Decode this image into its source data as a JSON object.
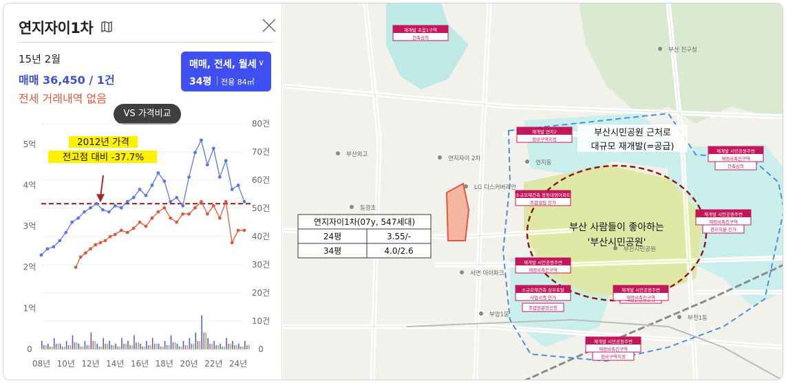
{
  "panel": {
    "title": "연지자이1차",
    "icon": "map-icon",
    "date": "15년 2월",
    "sale_line": "매매 36,450 / 1건",
    "jeonse_line": "전세 거래내역 없음",
    "filter_types": "매매, 전세, 월세",
    "filter_pyeong": "34평",
    "filter_area": "전용 84㎡",
    "vs_button": "VS 가격비교",
    "colors": {
      "accent": "#3f4ff0",
      "sale": "#5b76e8",
      "jeonse": "#e0583c",
      "annotation_bg": "#fff200",
      "dashed_line": "#8b1a1a"
    }
  },
  "chart_data": {
    "type": "line",
    "x_ticks": [
      "08년",
      "10년",
      "12년",
      "14년",
      "16년",
      "18년",
      "20년",
      "22년",
      "24년"
    ],
    "y_left_ticks": [
      "0",
      "1억",
      "2억",
      "3억",
      "4억",
      "5억"
    ],
    "y_right_ticks": [
      "0",
      "10건",
      "20건",
      "30건",
      "40건",
      "50건",
      "60건",
      "70건",
      "80건"
    ],
    "ylim_left": [
      0,
      5.5
    ],
    "ylim_right": [
      0,
      80
    ],
    "annotation_lines": [
      "2012년 가격",
      "전고점 대비 -37.7%"
    ],
    "reference_line_value": 3.55,
    "series": [
      {
        "values_x": [
          2008.0,
          2008.5,
          2009.0,
          2009.5,
          2010.0,
          2010.5,
          2011.0,
          2011.5,
          2012.0,
          2012.5,
          2013.0,
          2013.5,
          2014.0,
          2014.5,
          2015.0,
          2015.5,
          2016.0,
          2016.5,
          2017.0,
          2017.5,
          2018.0,
          2018.5,
          2019.0,
          2019.5,
          2020.0,
          2020.5,
          2021.0,
          2021.5,
          2022.0,
          2022.5,
          2023.0,
          2023.5,
          2024.0,
          2024.5
        ],
        "values_y": [
          2.3,
          2.45,
          2.5,
          2.65,
          2.85,
          3.1,
          3.2,
          3.35,
          3.45,
          3.55,
          3.4,
          3.35,
          3.5,
          3.45,
          3.6,
          3.7,
          3.9,
          3.75,
          4.0,
          4.3,
          4.1,
          3.6,
          3.7,
          3.5,
          4.2,
          4.8,
          5.1,
          4.5,
          4.9,
          4.2,
          4.6,
          3.9,
          4.0,
          3.6
        ]
      },
      {
        "values_x": [
          2010.8,
          2011.2,
          2011.6,
          2012.0,
          2012.4,
          2012.8,
          2013.2,
          2013.6,
          2014.0,
          2014.5,
          2015.0,
          2015.5,
          2016.0,
          2016.5,
          2017.0,
          2017.5,
          2018.0,
          2018.5,
          2019.0,
          2019.5,
          2020.0,
          2020.5,
          2021.0,
          2021.5,
          2022.0,
          2022.5,
          2023.0,
          2023.5,
          2024.0,
          2024.5
        ],
        "values_y": [
          2.0,
          2.25,
          2.35,
          2.45,
          2.55,
          2.6,
          2.65,
          2.75,
          2.8,
          2.9,
          2.85,
          2.95,
          3.1,
          3.0,
          3.2,
          3.35,
          3.45,
          3.2,
          3.1,
          3.3,
          3.3,
          3.45,
          3.6,
          3.3,
          3.5,
          3.2,
          3.6,
          2.6,
          2.9,
          2.9
        ]
      }
    ],
    "volume_series": {
      "values_x": [
        2008.0,
        2008.5,
        2009.0,
        2009.5,
        2010.0,
        2010.5,
        2011.0,
        2011.5,
        2012.0,
        2012.5,
        2013.0,
        2013.5,
        2014.0,
        2014.5,
        2015.0,
        2015.5,
        2016.0,
        2016.5,
        2017.0,
        2017.5,
        2018.0,
        2018.5,
        2019.0,
        2019.5,
        2020.0,
        2020.5,
        2021.0,
        2021.5,
        2022.0,
        2022.5,
        2023.0,
        2023.5,
        2024.0,
        2024.5
      ],
      "values_y": [
        3,
        2,
        4,
        2,
        3,
        5,
        2,
        3,
        6,
        2,
        4,
        3,
        2,
        4,
        3,
        5,
        2,
        3,
        4,
        2,
        3,
        5,
        2,
        3,
        4,
        6,
        12,
        4,
        3,
        2,
        4,
        3,
        2,
        3
      ]
    }
  },
  "map": {
    "callout_title": "부산시민공원 근처로",
    "callout_sub": "대규모 재개발(=공급)",
    "park_label_1": "부산 사람들이 좋아하는",
    "park_label_2": "'부산시민공원'",
    "table_header": "연지자이1차(07y, 547세대)",
    "table_rows": [
      [
        "24평",
        "3.55/-"
      ],
      [
        "34평",
        "4.0/2.6"
      ]
    ],
    "pins": [
      {
        "line1": "재개발 초읍1구역",
        "line2": "건축심의"
      },
      {
        "line1": "재개발 연지2",
        "line2": "정비구역지정"
      },
      {
        "line1": "재개발 시민공원주변",
        "line2": "재정비촉진구역"
      },
      {
        "line1": "건축심의",
        "line2": ""
      },
      {
        "line1": "소규모재건축 정동대영아파트",
        "line2": "조합설립 인가"
      },
      {
        "line1": "재개발 시민공원주변",
        "line2": "재정비촉진구역"
      },
      {
        "line1": "관리처분 인가",
        "line2": ""
      },
      {
        "line1": "재개발 시민공원주변",
        "line2": "재정비촉진구역"
      },
      {
        "line1": "조합원분양신청",
        "line2": ""
      },
      {
        "line1": "소규모재건축 삼부토탈",
        "line2": "사업시행 인가"
      },
      {
        "line1": "재개발 시민공원주변",
        "line2": "재정비촉진구역"
      },
      {
        "line1": "조합원분양신청",
        "line2": ""
      },
      {
        "line1": "재개발 시민공원주변",
        "line2": "재정비촉진구역"
      },
      {
        "line1": "정비구역지정",
        "line2": ""
      }
    ],
    "places": [
      "연지동",
      "부암1동",
      "부전1동",
      "부산시민공원",
      "LG 디스커버리안",
      "연지자이 2차",
      "서면 아이파크",
      "부산 진구청",
      "동광초",
      "부산외고"
    ]
  }
}
